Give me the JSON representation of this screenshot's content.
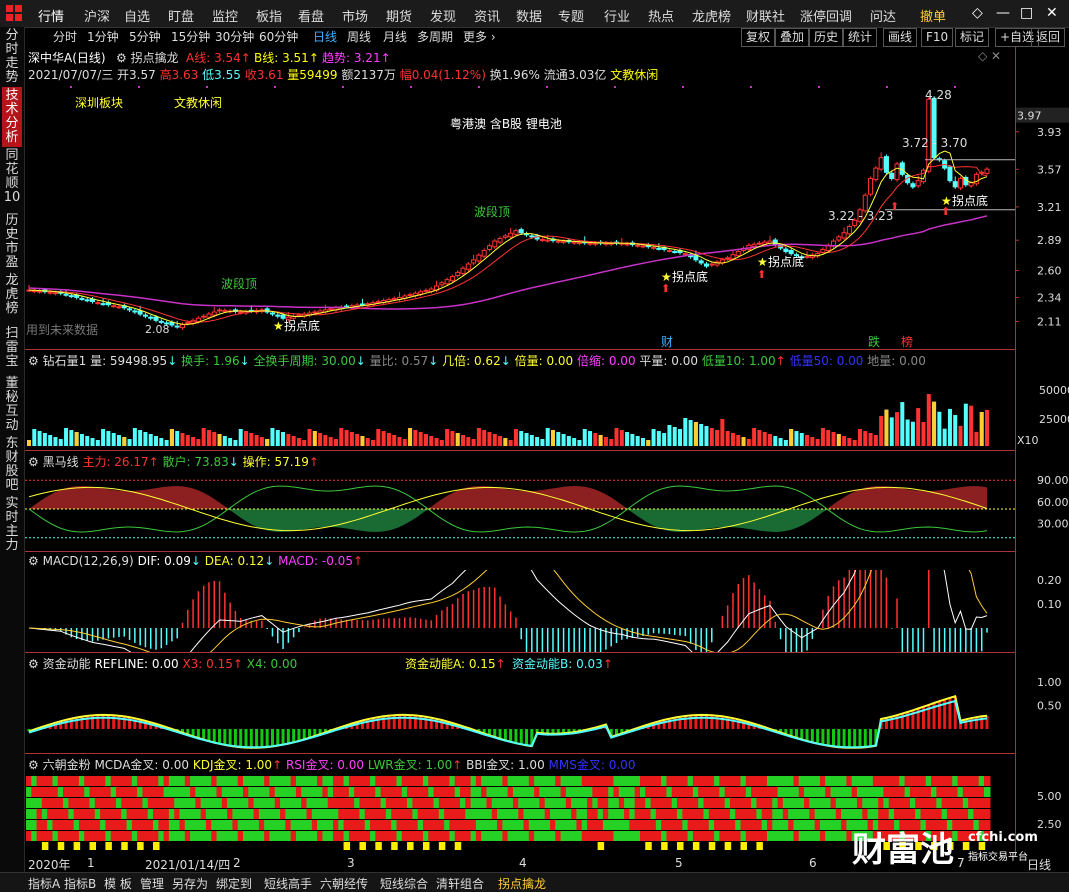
{
  "menu": [
    "行情",
    "沪深",
    "自选",
    "盯盘",
    "监控",
    "板指",
    "看盘",
    "市场",
    "期货",
    "发现",
    "资讯",
    "数据",
    "专题",
    "行业",
    "热点",
    "龙虎榜",
    "财联社",
    "涨停回调",
    "问达",
    "撤单"
  ],
  "window_controls": [
    "◇",
    "—",
    "□",
    "✕"
  ],
  "sidebar": [
    "分时走势",
    "技术分析",
    "同花顺10",
    "历史市盈",
    "龙虎榜",
    "扫雷宝",
    "董秘互动",
    "东财股吧",
    "实时主力"
  ],
  "timeframes": [
    "分时",
    "1分钟",
    "5分钟",
    "15分钟",
    "30分钟",
    "60分钟",
    "日线",
    "周线",
    "月线",
    "多周期",
    "更多 ›"
  ],
  "right_buttons": [
    "复权",
    "叠加",
    "历史",
    "统计",
    "画线",
    "F10",
    "标记",
    "+自选",
    "返回"
  ],
  "stock": {
    "name": "深中华A(日线)",
    "indicator": "拐点擒龙",
    "a_line": "A线: 3.54",
    "b_line": "B线: 3.51",
    "trend": "趋势: 3.21",
    "date": "2021/07/07/三",
    "open": "开3.57",
    "high": "高3.63",
    "low": "低3.55",
    "close": "收3.61",
    "volume": "量59499",
    "amount": "额2137万",
    "change": "幅0.04(1.12%)",
    "turnover": "换1.96%",
    "float": "流通3.03亿",
    "industry": "文教休闲"
  },
  "main_chart": {
    "board": "深圳板块",
    "sector": "文教休闲",
    "concepts": "粤港澳 含B股 锂电池",
    "y_ticks": [
      "3.97",
      "3.93",
      "3.57",
      "3.21",
      "2.89",
      "2.60",
      "2.34",
      "2.11"
    ],
    "annotations": {
      "high": "4.28",
      "range1": "3.72 - 3.70",
      "range2": "3.22 - 3.23",
      "low": "2.08",
      "future": "用到未来数据",
      "wave_top": "波段顶",
      "turn_bottom": "拐点底"
    },
    "markers": {
      "cai": "财",
      "die": "跌",
      "bang": "榜"
    }
  },
  "volume_panel": {
    "name": "钻石量1",
    "volume": "量: 59498.95",
    "turnover": "换手: 1.96",
    "full_period": "全换手周期: 30.00",
    "ratio": "量比: 0.57",
    "times": "几倍: 0.62",
    "double": "倍量: 0.00",
    "shrink": "倍缩: 0.00",
    "flat": "平量: 0.00",
    "low10": "低量10: 1.00",
    "low50": "低量50: 0.00",
    "ground": "地量: 0.00",
    "y_ticks": [
      "50000",
      "25000"
    ],
    "unit": "X10"
  },
  "horse_panel": {
    "name": "黑马线",
    "main": "主力: 26.17",
    "retail": "散户: 73.83",
    "op": "操作: 57.19",
    "y_ticks": [
      "90.00",
      "60.00",
      "30.00"
    ]
  },
  "macd_panel": {
    "name": "MACD(12,26,9)",
    "dif": "DIF: 0.09",
    "dea": "DEA: 0.12",
    "macd": "MACD: -0.05",
    "y_ticks": [
      "0.20",
      "0.10"
    ]
  },
  "fund_panel": {
    "name": "资金动能",
    "refline": "REFLINE: 0.00",
    "x3": "X3: 0.15",
    "x4": "X4: 0.00",
    "a": "资金动能A: 0.15",
    "b": "资金动能B: 0.03",
    "y_ticks": [
      "1.00",
      "0.50"
    ]
  },
  "six_panel": {
    "name": "六朝金粉",
    "mcda": "MCDA金叉: 0.00",
    "kdj": "KDJ金叉: 1.00",
    "rsi": "RSI金叉: 0.00",
    "lwr": "LWR金叉: 1.00",
    "bbi": "BBI金叉: 1.00",
    "mms": "MMS金叉: 0.00",
    "y_ticks": [
      "5.00",
      "2.50"
    ]
  },
  "time_axis": {
    "year": "2020年",
    "date": "2021/01/14/四",
    "months": [
      "1",
      "2",
      "3",
      "4",
      "5",
      "6",
      "7"
    ],
    "period": "日线"
  },
  "watermark": {
    "brand": "财富池",
    "url": "cfchi.com",
    "slogan": "指标交易平台"
  },
  "bottom_tabs": [
    "指标A",
    "指标B",
    "模 板",
    "管理",
    "另存为",
    "绑定到",
    "短线高手",
    "六朝经传",
    "短线综合",
    "清轩组合",
    "拐点擒龙"
  ],
  "colors": {
    "up": "#ff3232",
    "down": "#54ffff",
    "accent": "#3fb0ff",
    "active_tab": "#b4141a"
  }
}
